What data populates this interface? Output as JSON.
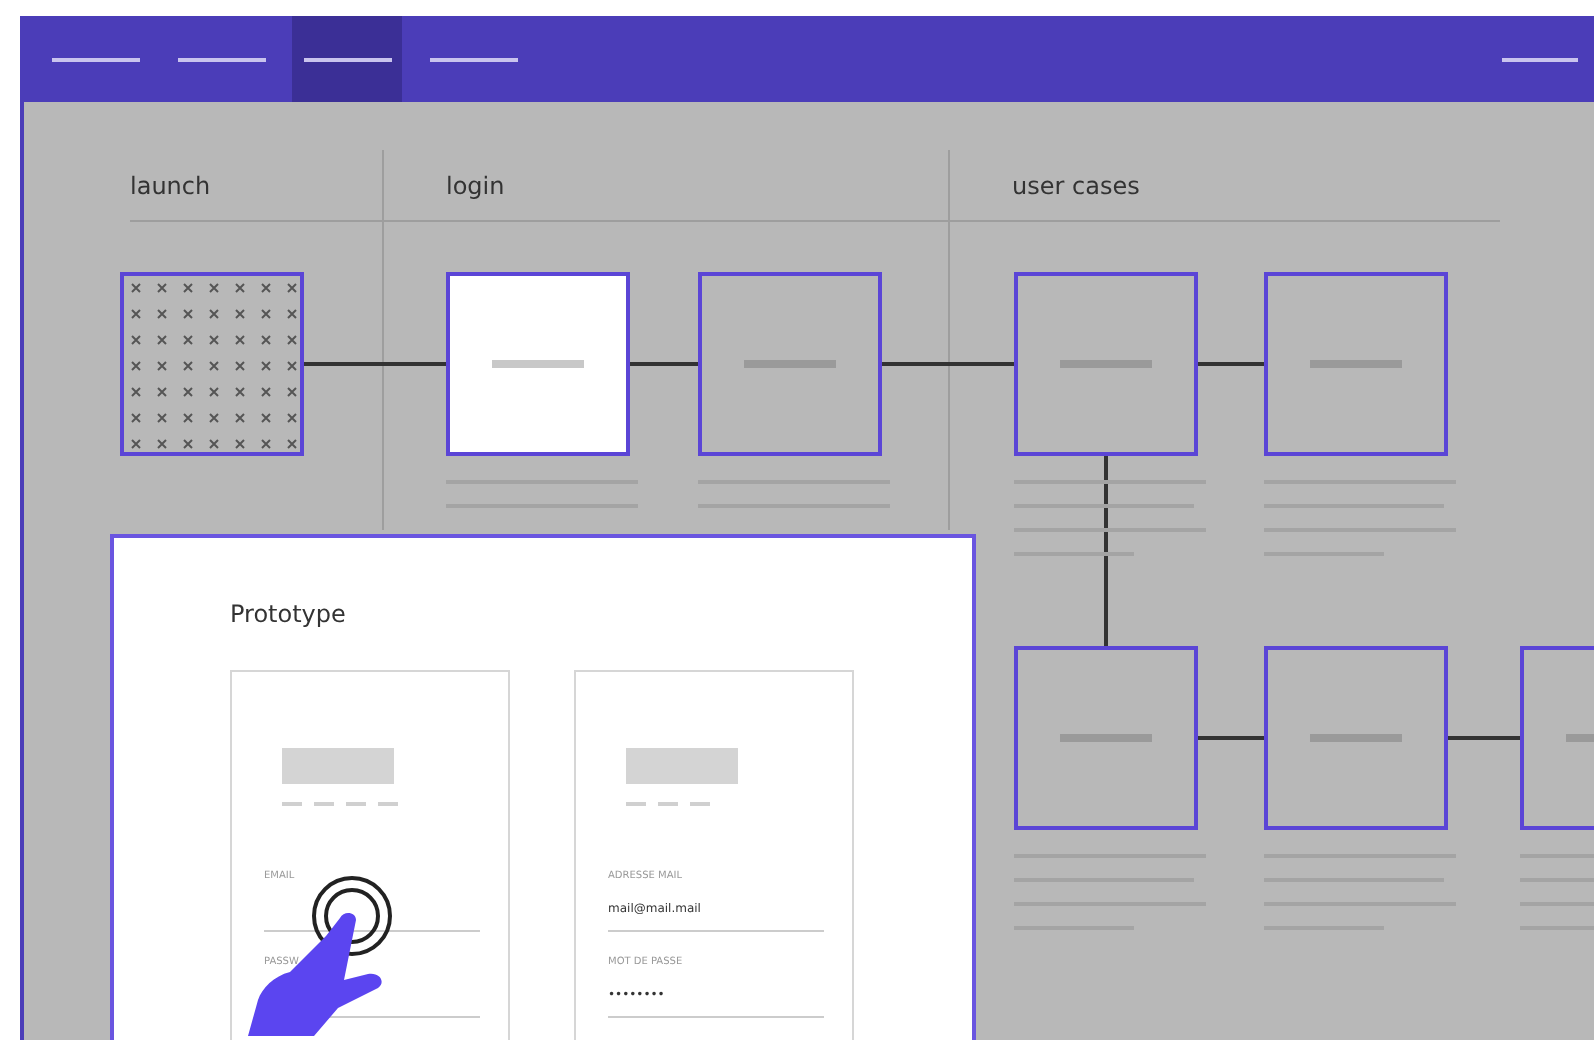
{
  "nav": {
    "tabs": [
      {
        "selected": false
      },
      {
        "selected": false
      },
      {
        "selected": true
      },
      {
        "selected": false
      }
    ]
  },
  "columns": [
    {
      "label": "launch"
    },
    {
      "label": "login"
    },
    {
      "label": "user cases"
    }
  ],
  "nodes": [
    {
      "kind": "pattern",
      "selected": false
    },
    {
      "kind": "screen",
      "selected": true
    },
    {
      "kind": "screen",
      "selected": false
    },
    {
      "kind": "screen",
      "selected": false
    },
    {
      "kind": "screen",
      "selected": false
    },
    {
      "kind": "screen",
      "selected": false
    },
    {
      "kind": "screen",
      "selected": false
    },
    {
      "kind": "screen",
      "selected": false
    }
  ],
  "prototype": {
    "title": "Prototype",
    "screens": [
      {
        "fields": [
          {
            "label": "EMAIL"
          },
          {
            "label": "PASSW"
          }
        ]
      },
      {
        "fields": [
          {
            "label": "ADRESSE MAIL",
            "value": "mail@mail.mail"
          },
          {
            "label": "MOT DE PASSE",
            "value": "••••••••"
          }
        ]
      }
    ]
  }
}
